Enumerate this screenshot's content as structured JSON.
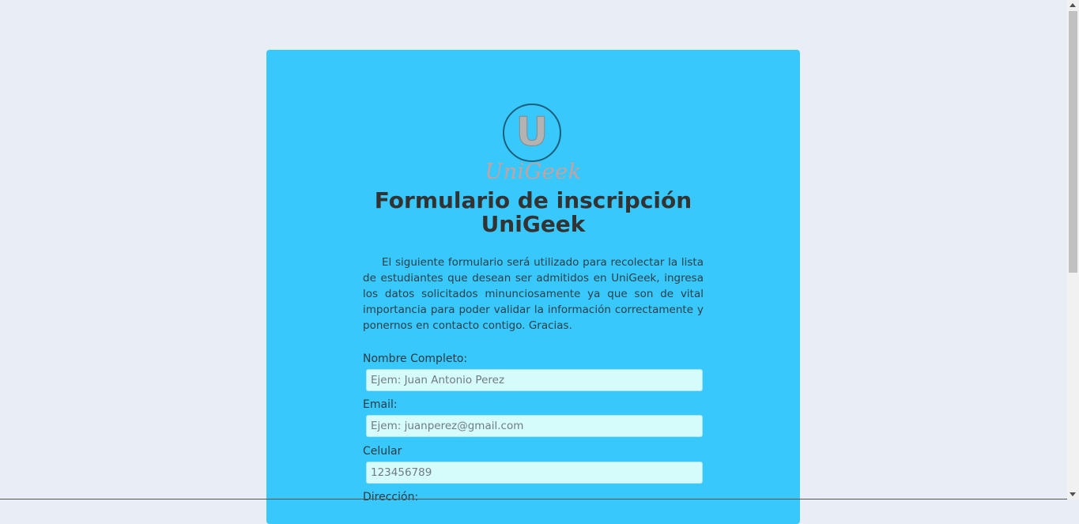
{
  "logo": {
    "letter": "U",
    "name": "UniGeek"
  },
  "title_line1": "Formulario de inscripción",
  "title_line2": "UniGeek",
  "intro": "El siguiente formulario será utilizado para recolectar la lista de estudiantes que desean ser admitidos en UniGeek, ingresa los datos solicitados minunciosamente ya que son de vital importancia para poder validar la información correctamente y ponernos en contacto contigo. Gracias.",
  "fields": [
    {
      "label": "Nombre Completo:",
      "placeholder": "Ejem: Juan Antonio Perez",
      "value": ""
    },
    {
      "label": "Email:",
      "placeholder": "Ejem: juanperez@gmail.com",
      "value": ""
    },
    {
      "label": "Celular",
      "placeholder": "123456789",
      "value": ""
    },
    {
      "label": "Dirección:"
    }
  ],
  "colors": {
    "background": "#e9edf5",
    "card": "#38c8fb",
    "input": "#d6fbfb",
    "title": "#333333"
  }
}
